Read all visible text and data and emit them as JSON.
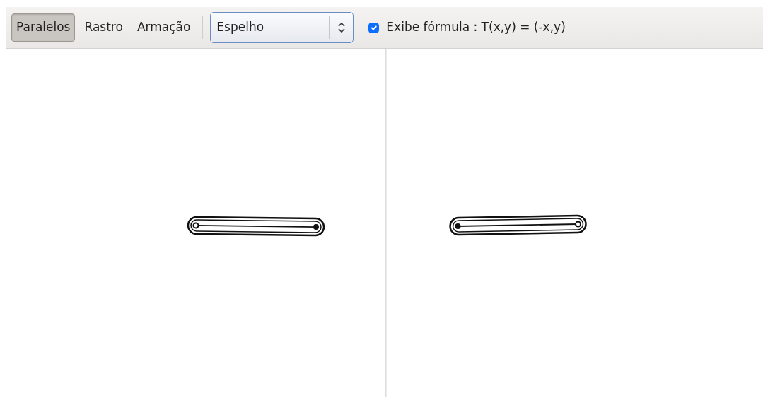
{
  "toolbar": {
    "buttons": [
      {
        "label": "Paralelos",
        "selected": true
      },
      {
        "label": "Rastro",
        "selected": false
      },
      {
        "label": "Armação",
        "selected": false
      }
    ],
    "transform_select": {
      "value": "Espelho"
    },
    "formula_toggle": {
      "label": "Exibe fórmula : T(x,y) = (-x,y)",
      "checked": true
    }
  }
}
